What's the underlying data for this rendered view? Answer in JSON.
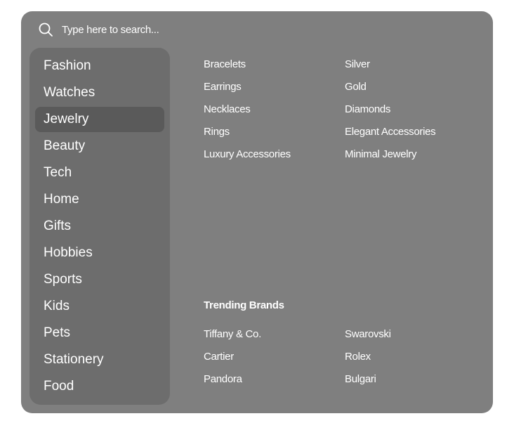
{
  "search": {
    "placeholder": "Type here to search...",
    "icon": "search-icon"
  },
  "sidebar": {
    "active": "Jewelry",
    "items": [
      {
        "label": "Fashion"
      },
      {
        "label": "Watches"
      },
      {
        "label": "Jewelry"
      },
      {
        "label": "Beauty"
      },
      {
        "label": "Tech"
      },
      {
        "label": "Home"
      },
      {
        "label": "Gifts"
      },
      {
        "label": "Hobbies"
      },
      {
        "label": "Sports"
      },
      {
        "label": "Kids"
      },
      {
        "label": "Pets"
      },
      {
        "label": "Stationery"
      },
      {
        "label": "Food"
      }
    ]
  },
  "subcategories": {
    "column1": [
      "Bracelets",
      "Earrings",
      "Necklaces",
      "Rings",
      "Luxury Accessories"
    ],
    "column2": [
      "Silver",
      "Gold",
      "Diamonds",
      "Elegant Accessories",
      "Minimal Jewelry"
    ]
  },
  "brands": {
    "heading": "Trending Brands",
    "column1": [
      "Tiffany & Co.",
      "Cartier",
      "Pandora"
    ],
    "column2": [
      "Swarovski",
      "Rolex",
      "Bulgari"
    ]
  },
  "colors": {
    "panel": "#7f7f7f",
    "sidebar": "#6d6d6d",
    "active_item": "#5a5a5a",
    "text": "#ffffff"
  }
}
